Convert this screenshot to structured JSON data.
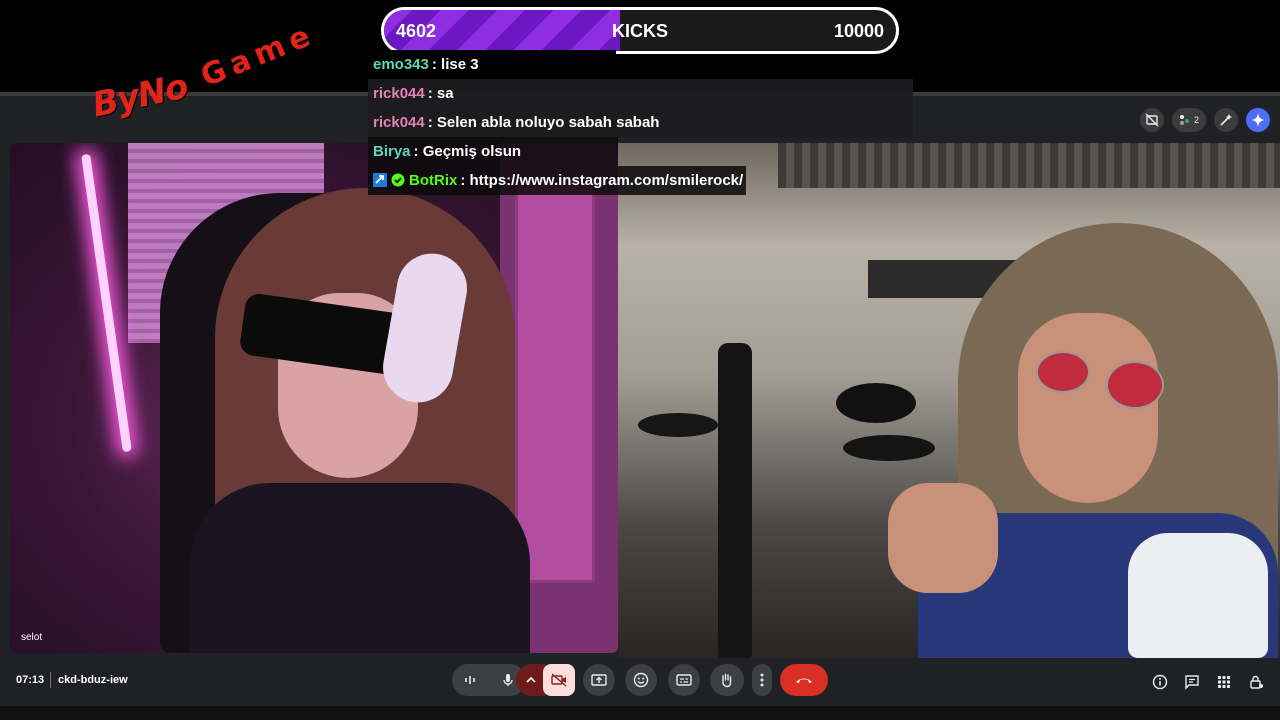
{
  "kicks": {
    "current": "4602",
    "label": "KICKS",
    "goal": "10000",
    "progress_fraction": 0.46,
    "fill_color": "#8e2ee0"
  },
  "logo": {
    "left_text": "ByNo",
    "right_text": "Game"
  },
  "chat": [
    {
      "user": "emo343",
      "user_color": "#5ed6b1",
      "text": ": lise 3"
    },
    {
      "user": "rick044",
      "user_color": "#e77fb7",
      "text": ": sa"
    },
    {
      "user": "rick044",
      "user_color": "#e77fb7",
      "text": ": Selen abla noluyo sabah sabah"
    },
    {
      "user": "Birya",
      "user_color": "#5ed6b1",
      "text": ": Geçmiş olsun"
    },
    {
      "user": "BotRix",
      "user_color": "#53fc18",
      "text": ": https://www.instagram.com/smilerock/",
      "badges": [
        "bot-badge-icon",
        "verified-badge-icon"
      ]
    }
  ],
  "meet": {
    "participant_count": "2",
    "left_tile_name": "selot",
    "time": "07:13",
    "meeting_code": "ckd-bduz-iew"
  },
  "colors": {
    "hangup": "#d93025",
    "meet_bg": "#202124",
    "camera_off_bg": "#f9dedc"
  }
}
